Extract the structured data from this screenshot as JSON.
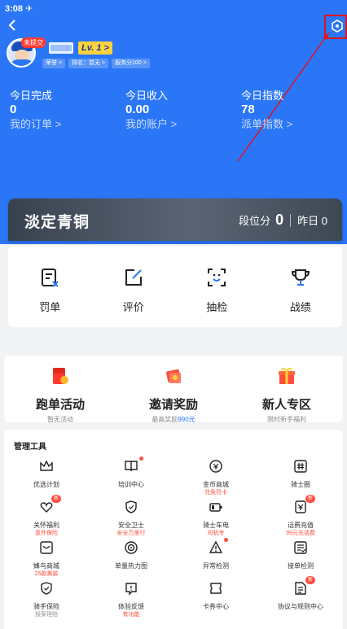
{
  "status_bar": {
    "time": "3:08 ✈"
  },
  "header": {
    "back_icon": "chevron-left-icon",
    "settings_icon": "hexagon-icon",
    "unsubmitted_badge": "未提交",
    "level_label": "Lv. 1 >",
    "chips": [
      "荣誉 >",
      "排名：暂无 >",
      "服务分100 >"
    ],
    "accent_color": "#2a76f7",
    "annotation_color": "#e0141e"
  },
  "stats": [
    {
      "label": "今日完成",
      "value": "0",
      "link": "我的订单 >"
    },
    {
      "label": "今日收入",
      "value": "0.00",
      "link": "我的账户 >"
    },
    {
      "label": "今日指数",
      "value": "78",
      "link": "派单指数 >"
    }
  ],
  "rank": {
    "name": "淡定青铜",
    "score_label": "段位分",
    "score": "0",
    "yesterday": "昨日 0"
  },
  "quick_actions": [
    {
      "label": "罚单",
      "icon": "ticket-icon"
    },
    {
      "label": "评价",
      "icon": "edit-icon"
    },
    {
      "label": "抽检",
      "icon": "scan-face-icon"
    },
    {
      "label": "战绩",
      "icon": "trophy-icon"
    }
  ],
  "activities": [
    {
      "title": "跑单活动",
      "sub": "暂无活动",
      "icon": "red-packet-icon"
    },
    {
      "title": "邀请奖励",
      "sub_prefix": "最高奖励",
      "sub_highlight": "990元",
      "icon": "gift-money-icon"
    },
    {
      "title": "新人专区",
      "sub": "限时新手福利",
      "icon": "gift-box-icon"
    }
  ],
  "tools": {
    "title": "管理工具",
    "items": [
      {
        "label": "优选计划",
        "sub": "",
        "icon": "crown-icon"
      },
      {
        "label": "培训中心",
        "sub": "",
        "icon": "book-icon",
        "dot": true
      },
      {
        "label": "金币商城",
        "sub": "兑免罚卡",
        "icon": "coin-icon"
      },
      {
        "label": "骑士圈",
        "sub": "",
        "icon": "hashtag-icon"
      },
      {
        "label": "关怀福利",
        "sub": "意外保险",
        "icon": "heart-icon",
        "badge": "新"
      },
      {
        "label": "安全卫士",
        "sub": "安全万里行",
        "icon": "shield-icon"
      },
      {
        "label": "骑士车电",
        "sub": "司机专",
        "icon": "battery-icon"
      },
      {
        "label": "话费充值",
        "sub": "99元充话费",
        "icon": "phone-bill-icon",
        "badge": "新"
      },
      {
        "label": "蜂鸟商城",
        "sub": "25款美装",
        "icon": "shop-icon"
      },
      {
        "label": "单量热力图",
        "sub": "",
        "icon": "target-icon"
      },
      {
        "label": "异常检测",
        "sub": "",
        "icon": "warning-icon",
        "dot": true
      },
      {
        "label": "接单检测",
        "sub": "",
        "icon": "checklist-icon"
      },
      {
        "label": "骑手保险",
        "sub": "报案理赔",
        "icon": "shield-check-icon",
        "gray": true
      },
      {
        "label": "体验反馈",
        "sub": "有功能",
        "icon": "feedback-icon"
      },
      {
        "label": "卡券中心",
        "sub": "",
        "icon": "coupon-icon"
      },
      {
        "label": "协议与规则中心",
        "sub": "",
        "icon": "document-icon",
        "badge": "新"
      }
    ]
  }
}
